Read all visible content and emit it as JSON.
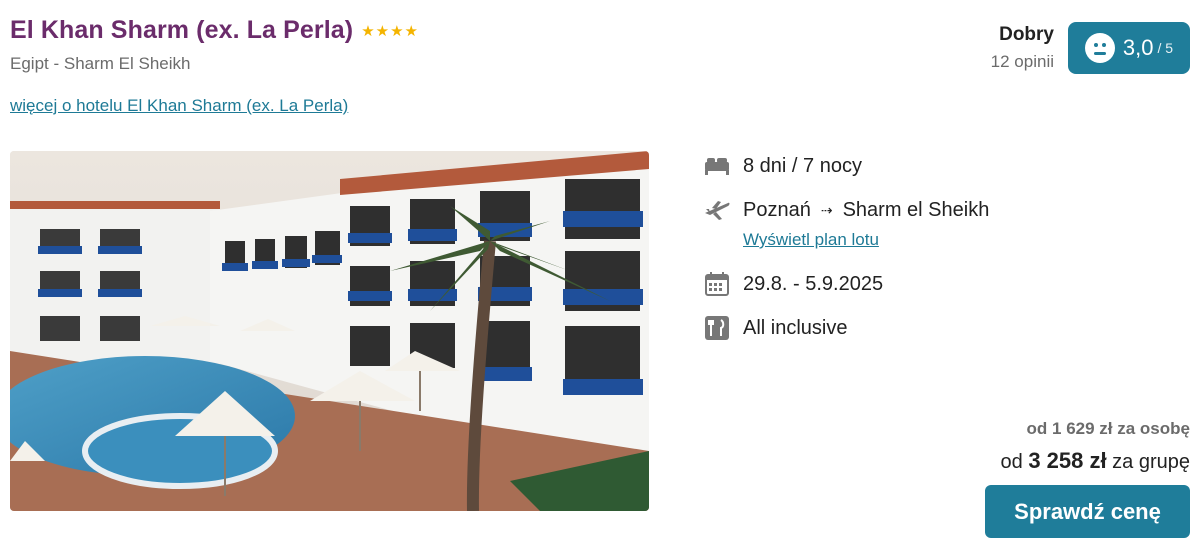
{
  "hotel": {
    "name": "El Khan Sharm (ex. La Perla)",
    "stars": "★★★★",
    "location": "Egipt - Sharm El Sheikh",
    "more_link": "więcej o hotelu El Khan Sharm (ex. La Perla)"
  },
  "rating": {
    "label": "Dobry",
    "reviews": "12 opinii",
    "score": "3,0",
    "max": "/ 5",
    "icon": "neutral-face-icon",
    "badge_color": "#1f7d9a"
  },
  "details": {
    "duration": "8 dni / 7 nocy",
    "departure": "Poznań",
    "destination": "Sharm el Sheikh",
    "flight_plan_link": "Wyświetl plan lotu",
    "dates": "29.8. - 5.9.2025",
    "board": "All inclusive",
    "icons": [
      "bed-icon",
      "plane-icon",
      "calendar-icon",
      "food-icon"
    ]
  },
  "price": {
    "per_person": "od 1 629 zł za osobę",
    "group_prefix": "od",
    "group_amount": "3 258 zł",
    "group_suffix": "za grupę",
    "button": "Sprawdź cenę"
  },
  "colors": {
    "title": "#6b2c6b",
    "accent": "#1f7d9a",
    "star": "#f4b400"
  }
}
